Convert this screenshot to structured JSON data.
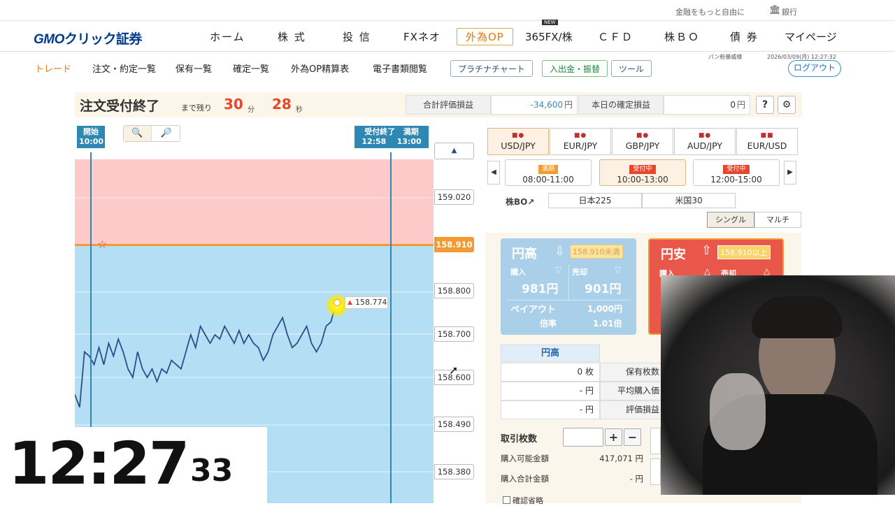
{
  "top_bar": {
    "tagline": "金融をもっと自由に",
    "bank_link": "銀行"
  },
  "logo": {
    "text_gmo": "GMO",
    "text_rest": "クリック証券"
  },
  "main_nav": [
    {
      "label": "ホーム"
    },
    {
      "label": "株 式"
    },
    {
      "label": "投 信"
    },
    {
      "label": "FXネオ"
    },
    {
      "label": "外為OP",
      "active": true
    },
    {
      "label": "365FX/株",
      "badge": "NEW"
    },
    {
      "label": "ＣＦＤ"
    },
    {
      "label": "株ＢＯ"
    },
    {
      "label": "債 券"
    },
    {
      "label": "マイページ"
    }
  ],
  "sub_nav": {
    "items": [
      "トレード",
      "注文・約定一覧",
      "保有一覧",
      "確定一覧",
      "外為OP精算表",
      "電子書類閲覧"
    ],
    "buttons": [
      "プラチナチャート",
      "入出金・振替",
      "ツール"
    ],
    "logout": "ログアウト",
    "user": "パン粉暴威様",
    "datetime": "2026/03/09(月) 12:27:32"
  },
  "order_header": {
    "title": "注文受付終了",
    "remain_label": "まで残り",
    "minutes": "30",
    "min_unit": "分",
    "seconds": "28",
    "sec_unit": "秒",
    "total_pnl_label": "合計評価損益",
    "total_pnl_value": "-34,600",
    "yen": "円",
    "today_pnl_label": "本日の確定損益",
    "today_pnl_value": "0",
    "help": "?",
    "settings_icon": "gear-icon"
  },
  "chart": {
    "start_label": "開始",
    "start_time": "10:00",
    "close_label": "受付終了",
    "close_time": "12:58",
    "expiry_label": "満期",
    "expiry_time": "13:00",
    "price_ticks": [
      "159.020",
      "158.910",
      "158.800",
      "158.700",
      "158.600",
      "158.490",
      "158.380"
    ],
    "strike": "158.910",
    "current_price": "158.774"
  },
  "chart_data": {
    "type": "line",
    "ylim": [
      158.35,
      159.12
    ],
    "strike": 158.91,
    "x_start": "10:00",
    "x_end": "13:00",
    "series": [
      {
        "values": [
          158.56,
          158.53,
          158.66,
          158.65,
          158.63,
          158.67,
          158.63,
          158.68,
          158.65,
          158.69,
          158.66,
          158.62,
          158.6,
          158.66,
          158.62,
          158.6,
          158.62,
          158.59,
          158.62,
          158.61,
          158.64,
          158.63,
          158.62,
          158.66,
          158.7,
          158.67,
          158.72,
          158.7,
          158.68,
          158.7,
          158.69,
          158.72,
          158.7,
          158.68,
          158.71,
          158.68,
          158.7,
          158.68,
          158.67,
          158.64,
          158.66,
          158.7,
          158.72,
          158.74,
          158.7,
          158.67,
          158.68,
          158.7,
          158.72,
          158.68,
          158.66,
          158.68,
          158.72,
          158.73,
          158.77,
          158.774
        ]
      }
    ]
  },
  "currency_tabs": [
    {
      "label": "USD/JPY",
      "active": true
    },
    {
      "label": "EUR/JPY"
    },
    {
      "label": "GBP/JPY"
    },
    {
      "label": "AUD/JPY"
    },
    {
      "label": "EUR/USD"
    }
  ],
  "sessions": [
    {
      "badge": "満期",
      "badge_color": "#f39b33",
      "time": "08:00-11:00"
    },
    {
      "badge": "受付中",
      "badge_color": "#e8462a",
      "time": "10:00-13:00",
      "active": true
    },
    {
      "badge": "受付中",
      "badge_color": "#e8462a",
      "time": "12:00-15:00"
    }
  ],
  "index_row": {
    "label": "株BO↗",
    "items": [
      "日本225",
      "米国30"
    ]
  },
  "modes": [
    "シングル",
    "マルチ"
  ],
  "yen_high": {
    "title": "円高",
    "strike": "158.910未満",
    "buy_label": "購入",
    "sell_label": "売却",
    "buy_price": "981円",
    "sell_price": "901円",
    "payout_label": "ペイアウト",
    "payout_value": "1,000円",
    "rate_label": "倍率",
    "rate_value": "1.01倍"
  },
  "yen_low": {
    "title": "円安",
    "strike": "158.910以上",
    "buy_label": "購入",
    "sell_label": "売却"
  },
  "positions": {
    "header": "円高",
    "rows": [
      {
        "value": "0 枚",
        "label": "保有枚数"
      },
      {
        "value": "- 円",
        "label": "平均購入価"
      },
      {
        "value": "- 円",
        "label": "評価損益"
      }
    ]
  },
  "trade_form": {
    "qty_label": "取引枚数",
    "plus": "+",
    "minus": "−",
    "buyable_label": "購入可能金額",
    "buyable_value": "417,071 円",
    "total_label": "購入合計金額",
    "total_value": "- 円",
    "confirm_skip": "確認省略"
  },
  "clock": {
    "hm": "12:27",
    "s": "33"
  }
}
